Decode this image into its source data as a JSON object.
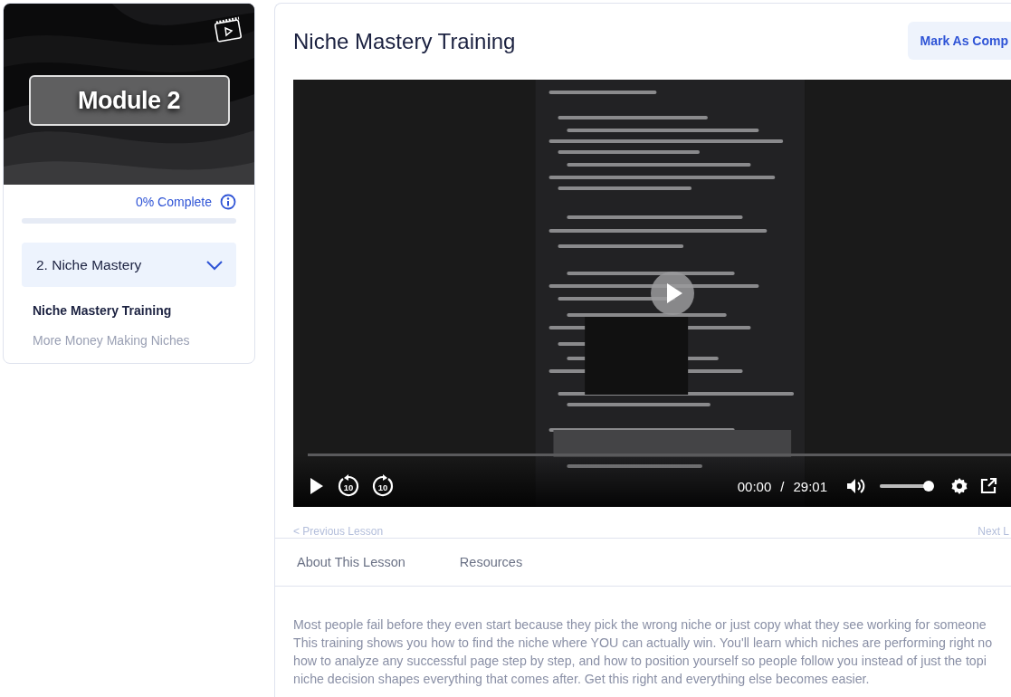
{
  "module_card": {
    "thumbnail": {
      "kind": "picture",
      "label": "Module 2"
    },
    "progress": {
      "text": "0% Complete",
      "level": 0
    },
    "section": {
      "title": "2. Niche Mastery",
      "expanded": true,
      "lessons": [
        {
          "title": "Niche Mastery Training",
          "selected": true
        },
        {
          "title": "More Money Making Niches",
          "selected": false
        }
      ]
    }
  },
  "lesson": {
    "title": "Niche Mastery Training",
    "mark_complete_button": "Mark As Comp",
    "video": {
      "progress": {
        "level": 0
      },
      "rewind_label": "10",
      "forward_label": "10",
      "current_time": "00:00",
      "separator": "/",
      "duration": "29:01",
      "volume": {
        "level": 1
      }
    },
    "previous_link": "< Previous Lesson",
    "next_link": "Next L",
    "tabs": [
      {
        "label": "About This Lesson"
      },
      {
        "label": "Resources"
      }
    ],
    "description_lines": [
      "Most people fail before they even start because they pick the wrong niche or just copy what they see working for someone",
      "This training shows you how to find the niche where YOU can actually win. You'll learn which niches are performing right no",
      "how to analyze any successful page step by step, and how to position yourself so people follow you instead of just the topi",
      "niche decision shapes everything that comes after. Get this right and everything else becomes easier."
    ]
  }
}
